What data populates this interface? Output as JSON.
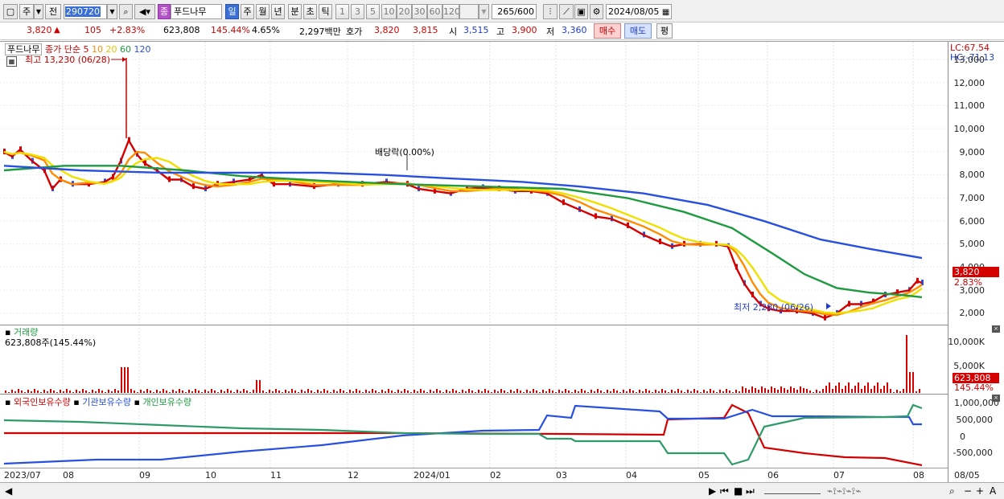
{
  "toolbar": {
    "type_label": "주",
    "prev_label": "전",
    "code_value": "290720",
    "stock_name": "푸드나무",
    "tag_label": "종",
    "periods": [
      "일",
      "주",
      "월",
      "년",
      "분",
      "초",
      "틱"
    ],
    "minute_options": [
      "1",
      "3",
      "5",
      "10",
      "20",
      "30",
      "60",
      "120"
    ],
    "count_value": "265",
    "count_total": "/600",
    "date_value": "2024/08/05"
  },
  "quote": {
    "price": "3,820",
    "change_arrow": "▲",
    "change": "105",
    "change_rate": "+2.83%",
    "volume": "623,808",
    "volume_rate": "145.44%",
    "turnover": "4.65%",
    "amount": "2,297백만",
    "hoga_label": "호가",
    "ask": "3,820",
    "bid": "3,815",
    "open_label": "시",
    "open": "3,515",
    "high_label": "고",
    "high": "3,900",
    "low_label": "저",
    "low": "3,360",
    "buy_label": "매수",
    "sell_label": "매도",
    "eval_label": "평"
  },
  "price_panel": {
    "name": "푸드나무",
    "ma_title": "종가 단순",
    "ma_periods": [
      "5",
      "10",
      "20",
      "60",
      "120"
    ],
    "ma_colors": [
      "#d40000",
      "#ff8c00",
      "#f0e000",
      "#1e9a40",
      "#2850e0"
    ],
    "max_label": "최고 13,230 (06/28)",
    "min_label": "최저 2,280 (06/26)",
    "dividend_label": "배당락(0.00%)",
    "lc_label": "LC:67.54",
    "hc_label": "HC:-71.13",
    "price_tag": "3,820",
    "rate_tag": "2.83%",
    "yticks": [
      "13,000",
      "12,000",
      "11,000",
      "10,000",
      "9,000",
      "8,000",
      "7,000",
      "6,000",
      "5,000",
      "4,000",
      "3,000",
      "2,000"
    ]
  },
  "volume_panel": {
    "title": "거래량",
    "value_text": "623,808주(145.44%)",
    "yticks": [
      "10,000K",
      "5,000K"
    ],
    "tag": "623,808",
    "tag_rate": "145.44%"
  },
  "holding_panel": {
    "series": [
      "외국인보유수량",
      "기관보유수량",
      "개인보유수량"
    ],
    "series_colors": [
      "#d40000",
      "#2850e0",
      "#1e9a40"
    ],
    "yticks": [
      "1,000,000",
      "500,000",
      "0",
      "-500,000"
    ]
  },
  "xaxis": {
    "labels": [
      "2023/07",
      "08",
      "09",
      "10",
      "11",
      "12",
      "2024/01",
      "02",
      "03",
      "04",
      "05",
      "06",
      "07",
      "08"
    ],
    "end_label": "08/05"
  }
}
